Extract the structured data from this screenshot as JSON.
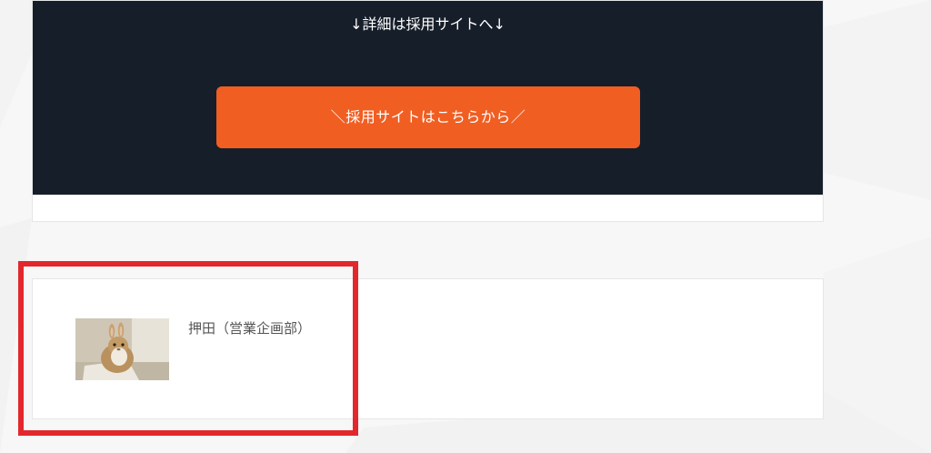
{
  "recruit": {
    "lead": "↓詳細は採用サイトへ↓",
    "button_label": "＼採用サイトはこちらから／"
  },
  "author": {
    "name": "押田（営業企画部）",
    "avatar_icon": "rabbit-photo-thumbnail"
  },
  "colors": {
    "dark_section": "#161e29",
    "cta_orange": "#f15e22",
    "highlight_red": "#e2282c",
    "page_bg": "#f7f7f7"
  }
}
